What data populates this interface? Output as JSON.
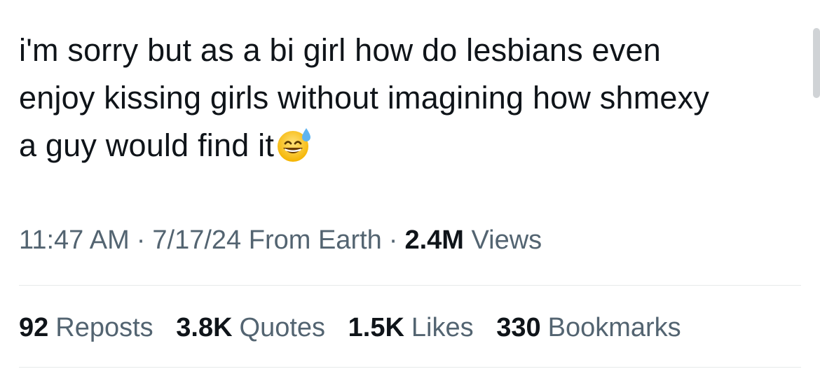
{
  "tweet": {
    "lines": [
      "i'm sorry but as a bi girl how do lesbians even",
      "enjoy kissing girls without imagining how shmexy",
      "a guy would find it"
    ],
    "emoji": "grinning-face-with-sweat-icon"
  },
  "meta": {
    "time": "11:47 AM",
    "dot1": "·",
    "date": "7/17/24",
    "source": "From Earth",
    "dot2": "·",
    "views_count": "2.4M",
    "views_label": "Views"
  },
  "stats": {
    "reposts_count": "92",
    "reposts_label": "Reposts",
    "quotes_count": "3.8K",
    "quotes_label": "Quotes",
    "likes_count": "1.5K",
    "likes_label": "Likes",
    "bookmarks_count": "330",
    "bookmarks_label": "Bookmarks"
  }
}
